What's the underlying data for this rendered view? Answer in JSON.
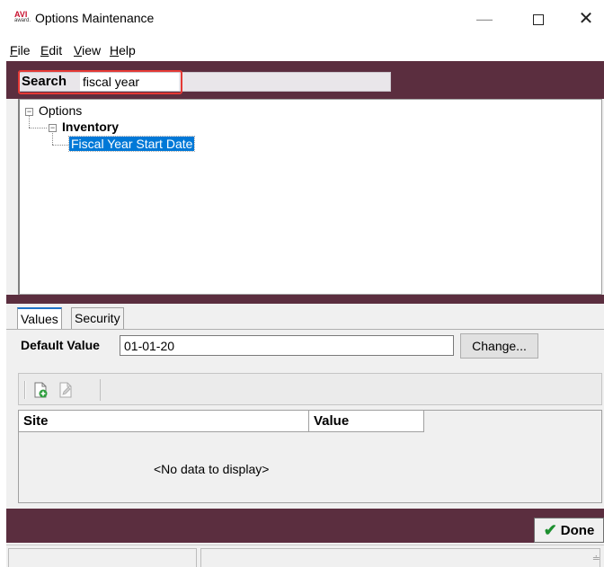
{
  "window": {
    "app_icon_text": "AVI",
    "app_icon_sub": "award.",
    "title": "Options Maintenance"
  },
  "menu": {
    "items": [
      {
        "label": "File",
        "mnemonic": "F",
        "rest": "ile"
      },
      {
        "label": "Edit",
        "mnemonic": "E",
        "rest": "dit"
      },
      {
        "label": "View",
        "mnemonic": "V",
        "rest": "iew"
      },
      {
        "label": "Help",
        "mnemonic": "H",
        "rest": "elp"
      }
    ]
  },
  "search": {
    "label": "Search",
    "value": "fiscal year"
  },
  "tree": {
    "root": "Options",
    "child": "Inventory",
    "leaf": "Fiscal Year Start Date"
  },
  "tabs": {
    "values": "Values",
    "security": "Security"
  },
  "default_value": {
    "label": "Default Value",
    "value": "01-01-20",
    "change_button": "Change..."
  },
  "grid": {
    "columns": [
      "Site",
      "Value"
    ],
    "empty_text": "<No data to display>"
  },
  "done_button": "Done",
  "icons": [
    "add-record-icon",
    "edit-record-icon",
    "checkmark-icon",
    "expand-collapse-icon"
  ]
}
